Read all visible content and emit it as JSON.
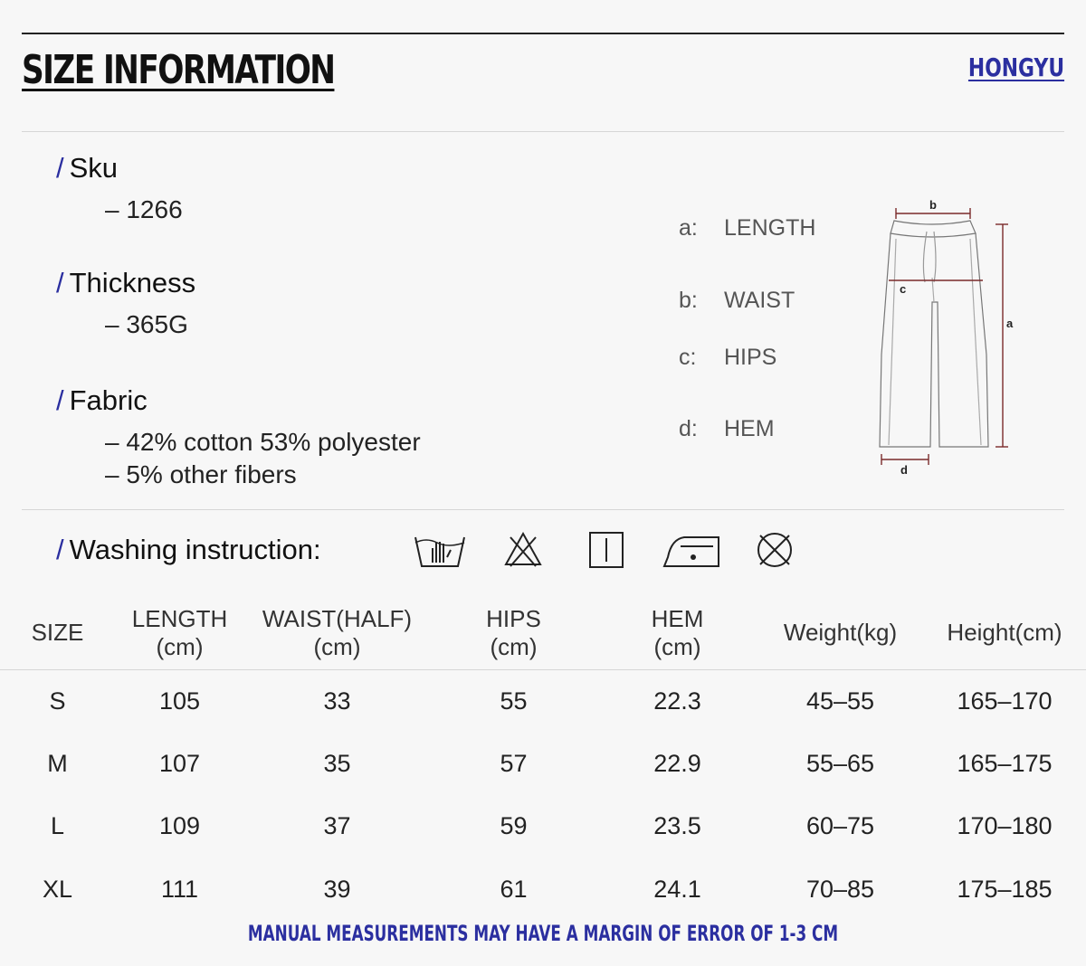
{
  "header": {
    "title": "SIZE INFORMATION",
    "brand": "HONGYU"
  },
  "details": {
    "sku": {
      "label": "Sku",
      "value": "– 1266"
    },
    "thickness": {
      "label": "Thickness",
      "value": "– 365G"
    },
    "fabric": {
      "label": "Fabric",
      "lines": [
        "– 42% cotton 53% polyester",
        "– 5% other fibers"
      ]
    }
  },
  "legend": [
    {
      "key": "a:",
      "label": "LENGTH"
    },
    {
      "key": "b:",
      "label": "WAIST"
    },
    {
      "key": "c:",
      "label": "HIPS"
    },
    {
      "key": "d:",
      "label": "HEM"
    }
  ],
  "diagram_labels": {
    "a": "a",
    "b": "b",
    "c": "c",
    "d": "d"
  },
  "washing": {
    "label": "Washing instruction:",
    "icons": [
      "hand-wash-icon",
      "do-not-bleach-icon",
      "line-dry-icon",
      "iron-low-heat-icon",
      "do-not-dry-clean-icon"
    ]
  },
  "size_table": {
    "headers": [
      [
        "SIZE"
      ],
      [
        "LENGTH",
        "(cm)"
      ],
      [
        "WAIST(HALF)",
        "(cm)"
      ],
      [
        "HIPS",
        "(cm)"
      ],
      [
        "HEM",
        "(cm)"
      ],
      [
        "Weight(kg)"
      ],
      [
        "Height(cm)"
      ]
    ],
    "rows": [
      [
        "S",
        "105",
        "33",
        "55",
        "22.3",
        "45–55",
        "165–170"
      ],
      [
        "M",
        "107",
        "35",
        "57",
        "22.9",
        "55–65",
        "165–175"
      ],
      [
        "L",
        "109",
        "37",
        "59",
        "23.5",
        "60–75",
        "170–180"
      ],
      [
        "XL",
        "111",
        "39",
        "61",
        "24.1",
        "70–85",
        "175–185"
      ]
    ]
  },
  "note": "MANUAL MEASUREMENTS MAY HAVE A MARGIN OF ERROR OF 1-3 CM",
  "colors": {
    "accent": "#2b2fa0",
    "text": "#222222",
    "background": "#f7f7f7",
    "rule": "#d6d6d6"
  }
}
